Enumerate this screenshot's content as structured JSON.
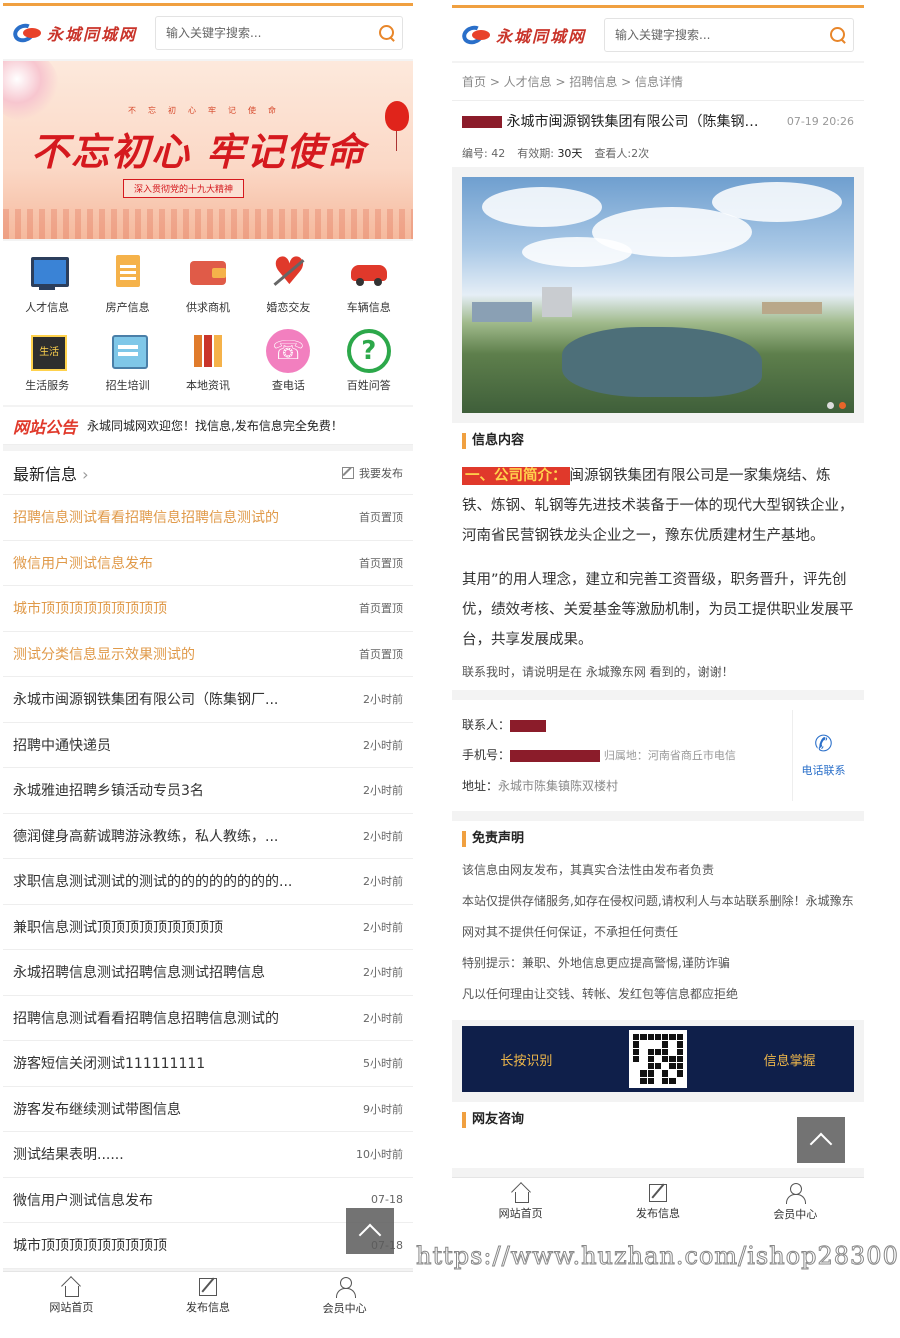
{
  "left": {
    "logo_text": "永城同城网",
    "search_placeholder": "输入关键字搜索...",
    "banner": {
      "small_top": "不忘初心牢记使命",
      "slogan": "不忘初心 牢记使命",
      "sub": "深入贯彻党的十九大精神"
    },
    "categories": [
      {
        "label": "人才信息",
        "icon": "monitor-icon"
      },
      {
        "label": "房产信息",
        "icon": "document-icon"
      },
      {
        "label": "供求商机",
        "icon": "wallet-icon"
      },
      {
        "label": "婚恋交友",
        "icon": "heart-icon"
      },
      {
        "label": "车辆信息",
        "icon": "car-icon"
      },
      {
        "label": "生活服务",
        "icon": "life-service-icon"
      },
      {
        "label": "招生培训",
        "icon": "cash-register-icon"
      },
      {
        "label": "本地资讯",
        "icon": "books-icon"
      },
      {
        "label": "查电话",
        "icon": "phone-icon"
      },
      {
        "label": "百姓问答",
        "icon": "question-icon"
      }
    ],
    "notice": {
      "title": "网站公告",
      "text": "永城同城网欢迎您！找信息,发布信息完全免费！"
    },
    "latest": {
      "title": "最新信息",
      "publish": "我要发布",
      "items": [
        {
          "title": "招聘信息测试看看招聘信息招聘信息测试的",
          "time": "首页置顶",
          "hot": true
        },
        {
          "title": "微信用户测试信息发布",
          "time": "首页置顶",
          "hot": true
        },
        {
          "title": "城市顶顶顶顶顶顶顶顶顶",
          "time": "首页置顶",
          "hot": true
        },
        {
          "title": "测试分类信息显示效果测试的",
          "time": "首页置顶",
          "hot": true
        },
        {
          "title": "永城市闽源钢铁集团有限公司（陈集钢厂...",
          "time": "2小时前",
          "hot": false
        },
        {
          "title": "招聘中通快递员",
          "time": "2小时前",
          "hot": false
        },
        {
          "title": "永城雅迪招聘乡镇活动专员3名",
          "time": "2小时前",
          "hot": false
        },
        {
          "title": "德润健身高薪诚聘游泳教练，私人教练，...",
          "time": "2小时前",
          "hot": false
        },
        {
          "title": "求职信息测试测试的测试的的的的的的的的...",
          "time": "2小时前",
          "hot": false
        },
        {
          "title": "兼职信息测试顶顶顶顶顶顶顶顶顶",
          "time": "2小时前",
          "hot": false
        },
        {
          "title": "永城招聘信息测试招聘信息测试招聘信息",
          "time": "2小时前",
          "hot": false
        },
        {
          "title": "招聘信息测试看看招聘信息招聘信息测试的",
          "time": "2小时前",
          "hot": false
        },
        {
          "title": "游客短信关闭测试111111111",
          "time": "5小时前",
          "hot": false
        },
        {
          "title": "游客发布继续测试带图信息",
          "time": "9小时前",
          "hot": false
        },
        {
          "title": "测试结果表明......",
          "time": "10小时前",
          "hot": false
        },
        {
          "title": "微信用户测试信息发布",
          "time": "07-18",
          "hot": false
        },
        {
          "title": "城市顶顶顶顶顶顶顶顶顶",
          "time": "07-18",
          "hot": false
        }
      ]
    },
    "tabbar": [
      "网站首页",
      "发布信息",
      "会员中心"
    ]
  },
  "right": {
    "logo_text": "永城同城网",
    "search_placeholder": "输入关键字搜索...",
    "breadcrumb": "首页 > 人才信息 > 招聘信息 > 信息详情",
    "detail": {
      "title": "永城市闽源钢铁集团有限公司（陈集钢厂...",
      "time": "07-19 20:26",
      "id_label": "编号:",
      "id": "42",
      "valid_label": "有效期:",
      "valid": "30天",
      "views_label": "查看人:",
      "views": "2次"
    },
    "content": {
      "header": "信息内容",
      "tag": "一、公司简介：",
      "p1": "闽源钢铁集团有限公司是一家集烧结、炼铁、炼钢、轧钢等先进技术装备于一体的现代大型钢铁企业，河南省民营钢铁龙头企业之一，豫东优质建材生产基地。",
      "p2": "其用”的用人理念，建立和完善工资晋级，职务晋升，评先创优，绩效考核、关爱基金等激励机制，为员工提供职业发展平台，共享发展成果。",
      "note": "联系我时，请说明是在 永城豫东网 看到的，谢谢！"
    },
    "contact": {
      "person_label": "联系人：",
      "phone_label": "手机号：",
      "belong": "归属地：河南省商丘市电信",
      "address_label": "地址：",
      "address": "永城市陈集镇陈双楼村",
      "call": "电话联系"
    },
    "disclaimer": {
      "header": "免责声明",
      "lines": [
        "该信息由网友发布，其真实合法性由发布者负责",
        "本站仅提供存储服务,如存在侵权问题,请权利人与本站联系删除！永城豫东网对其不提供任何保证，不承担任何责任",
        "特别提示：兼职、外地信息更应提高警惕,谨防诈骗",
        "凡以任何理由让交钱、转帐、发红包等信息都应拒绝"
      ]
    },
    "qr": {
      "left": "长按识别",
      "right": "信息掌握"
    },
    "consult": "网友咨询",
    "tabbar": [
      "网站首页",
      "发布信息",
      "会员中心"
    ]
  },
  "watermark": "https://www.huzhan.com/ishop28300",
  "colors": {
    "accent": "#f0a040",
    "hot": "#e09a4a",
    "red": "#e0392b",
    "link": "#2a6fc9"
  }
}
